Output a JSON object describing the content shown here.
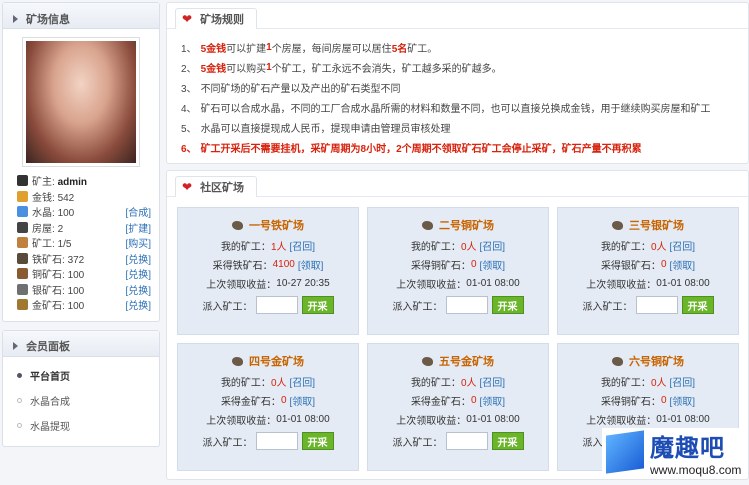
{
  "sidebar": {
    "info_title": "矿场信息",
    "stats": [
      {
        "label": "矿主:",
        "value": "admin",
        "action": "",
        "icon": "user-icon",
        "color": "#333333"
      },
      {
        "label": "金钱:",
        "value": "542",
        "action": "",
        "icon": "money-icon",
        "color": "#e0a030"
      },
      {
        "label": "水晶:",
        "value": "100",
        "action": "[合成]",
        "icon": "crystal-icon",
        "color": "#4a8fe0"
      },
      {
        "label": "房屋:",
        "value": "2",
        "action": "[扩建]",
        "icon": "house-icon",
        "color": "#444444"
      },
      {
        "label": "矿工:",
        "value": "1/5",
        "action": "[购买]",
        "icon": "miner-icon",
        "color": "#c08040"
      },
      {
        "label": "铁矿石:",
        "value": "372",
        "action": "[兑换]",
        "icon": "iron-ore-icon",
        "color": "#5a4a3a"
      },
      {
        "label": "铜矿石:",
        "value": "100",
        "action": "[兑换]",
        "icon": "copper-ore-icon",
        "color": "#8a5a30"
      },
      {
        "label": "银矿石:",
        "value": "100",
        "action": "[兑换]",
        "icon": "silver-ore-icon",
        "color": "#707070"
      },
      {
        "label": "金矿石:",
        "value": "100",
        "action": "[兑换]",
        "icon": "gold-ore-icon",
        "color": "#a07830"
      }
    ],
    "panel_title": "会员面板",
    "menu": [
      {
        "label": "平台首页",
        "active": true
      },
      {
        "label": "水晶合成",
        "active": false
      },
      {
        "label": "水晶提现",
        "active": false
      }
    ]
  },
  "rules": {
    "title": "矿场规则",
    "items": [
      {
        "num": "1、",
        "parts": [
          [
            "5金钱",
            "r"
          ],
          [
            "可以扩建",
            ""
          ],
          [
            "1",
            "r"
          ],
          [
            "个房屋，每间房屋可以居住",
            ""
          ],
          [
            "5名",
            "r"
          ],
          [
            "矿工。",
            ""
          ]
        ]
      },
      {
        "num": "2、",
        "parts": [
          [
            "5金钱",
            "r"
          ],
          [
            "可以购买",
            ""
          ],
          [
            "1",
            "r"
          ],
          [
            "个矿工，矿工永远不会消失，矿工越多采的矿越多。",
            ""
          ]
        ]
      },
      {
        "num": "3、",
        "parts": [
          [
            "不同矿场的矿石产量以及产出的矿石类型不同",
            ""
          ]
        ]
      },
      {
        "num": "4、",
        "parts": [
          [
            "矿石可以合成水晶，不同的工厂合成水晶所需的材料和数量不同，也可以直接兑换成金钱，用于继续购买房屋和矿工",
            ""
          ]
        ]
      },
      {
        "num": "5、",
        "parts": [
          [
            "水晶可以直接提现成人民币，提现申请由管理员审核处理",
            ""
          ]
        ]
      },
      {
        "num": "6、",
        "parts": [
          [
            "矿工开采后不需要挂机，采矿周期为8小时，2个周期不领取矿石矿工会停止采矿，矿石产量不再积累",
            ""
          ]
        ],
        "bold": true
      }
    ]
  },
  "mines": {
    "title": "社区矿场",
    "labels": {
      "my_miners": "我的矿工：",
      "recall": "[召回]",
      "claim": "[领取]",
      "last_claim": "上次领取收益：",
      "send": "派入矿工：",
      "start": "开采"
    },
    "items": [
      {
        "name": "一号铁矿场",
        "miners": "1人",
        "ore_label": "采得铁矿石：",
        "ore_value": "4100",
        "last": "10-27 20:35"
      },
      {
        "name": "二号铜矿场",
        "miners": "0人",
        "ore_label": "采得铜矿石：",
        "ore_value": "0",
        "last": "01-01 08:00"
      },
      {
        "name": "三号银矿场",
        "miners": "0人",
        "ore_label": "采得银矿石：",
        "ore_value": "0",
        "last": "01-01 08:00"
      },
      {
        "name": "四号金矿场",
        "miners": "0人",
        "ore_label": "采得金矿石：",
        "ore_value": "0",
        "last": "01-01 08:00"
      },
      {
        "name": "五号金矿场",
        "miners": "0人",
        "ore_label": "采得金矿石：",
        "ore_value": "0",
        "last": "01-01 08:00"
      },
      {
        "name": "六号铜矿场",
        "miners": "0人",
        "ore_label": "采得铜矿石：",
        "ore_value": "0",
        "last": "01-01 08:00"
      }
    ]
  },
  "watermark": {
    "main": "魔趣吧",
    "sub": "www.moqu8.com"
  }
}
